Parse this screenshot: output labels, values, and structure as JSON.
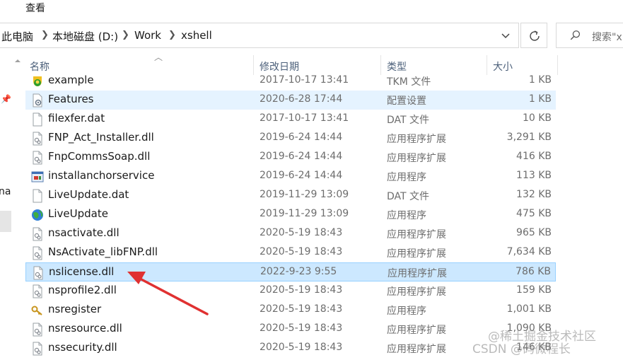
{
  "menu": {
    "view": "查看"
  },
  "breadcrumb": [
    "此电脑",
    "本地磁盘 (D:)",
    "Work",
    "xshell"
  ],
  "search": {
    "placeholder": "搜索\"x"
  },
  "nav": {
    "cut_text": "na"
  },
  "columns": {
    "name": "名称",
    "date": "修改日期",
    "type": "类型",
    "size": "大小"
  },
  "files": [
    {
      "name": "example",
      "date": "2017-10-17 13:41",
      "type": "TKM 文件",
      "size": "1 KB",
      "icon": "tkm-file-icon"
    },
    {
      "name": "Features",
      "date": "2020-6-28 17:44",
      "type": "配置设置",
      "size": "1 KB",
      "icon": "settings-file-icon"
    },
    {
      "name": "filexfer.dat",
      "date": "2017-10-17 13:41",
      "type": "DAT 文件",
      "size": "10 KB",
      "icon": "blank-file-icon"
    },
    {
      "name": "FNP_Act_Installer.dll",
      "date": "2019-6-24 14:44",
      "type": "应用程序扩展",
      "size": "3,291 KB",
      "icon": "dll-file-icon"
    },
    {
      "name": "FnpCommsSoap.dll",
      "date": "2019-6-24 14:44",
      "type": "应用程序扩展",
      "size": "416 KB",
      "icon": "dll-file-icon"
    },
    {
      "name": "installanchorservice",
      "date": "2019-6-24 14:44",
      "type": "应用程序",
      "size": "113 KB",
      "icon": "exe-file-icon"
    },
    {
      "name": "LiveUpdate.dat",
      "date": "2019-11-29 13:09",
      "type": "DAT 文件",
      "size": "132 KB",
      "icon": "blank-file-icon"
    },
    {
      "name": "LiveUpdate",
      "date": "2019-11-29 13:09",
      "type": "应用程序",
      "size": "475 KB",
      "icon": "globe-app-icon"
    },
    {
      "name": "nsactivate.dll",
      "date": "2020-5-19 18:43",
      "type": "应用程序扩展",
      "size": "965 KB",
      "icon": "dll-file-icon"
    },
    {
      "name": "NsActivate_libFNP.dll",
      "date": "2020-5-19 18:43",
      "type": "应用程序扩展",
      "size": "7,634 KB",
      "icon": "dll-file-icon"
    },
    {
      "name": "nslicense.dll",
      "date": "2022-9-23 9:55",
      "type": "应用程序扩展",
      "size": "786 KB",
      "icon": "dll-file-icon"
    },
    {
      "name": "nsprofile2.dll",
      "date": "2020-5-19 18:43",
      "type": "应用程序扩展",
      "size": "159 KB",
      "icon": "dll-file-icon"
    },
    {
      "name": "nsregister",
      "date": "2020-5-19 18:43",
      "type": "应用程序",
      "size": "1,001 KB",
      "icon": "key-app-icon"
    },
    {
      "name": "nsresource.dll",
      "date": "2020-5-19 18:43",
      "type": "应用程序扩展",
      "size": "1,090 KB",
      "icon": "dll-file-icon"
    },
    {
      "name": "nssecurity.dll",
      "date": "2020-5-19 18:43",
      "type": "应用程序扩展",
      "size": "146 KB",
      "icon": "dll-file-icon"
    }
  ],
  "watermark": {
    "line1": "@稀土掘金技术社区",
    "line2": "CSDN @码微程长"
  },
  "colors": {
    "selected_bg": "#cce8ff",
    "selected_border": "#99d1ff",
    "hover_bg": "#e5f3ff",
    "arrow": "#e03131"
  }
}
